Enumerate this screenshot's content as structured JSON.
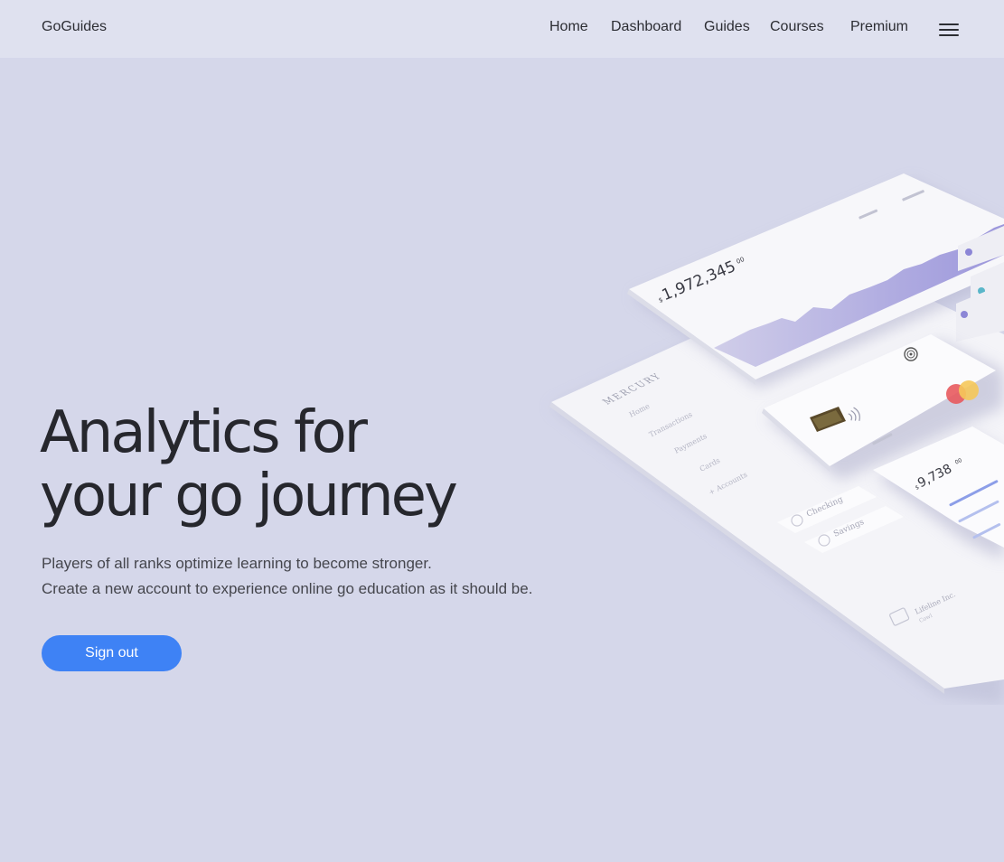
{
  "brand": "GoGuides",
  "nav": {
    "home": "Home",
    "dashboard": "Dashboard",
    "guides": "Guides",
    "courses": "Courses",
    "premium": "Premium"
  },
  "hero": {
    "title_line1": "Analytics for",
    "title_line2": "your go journey",
    "subtitle_line1": "Players of all ranks optimize learning to become stronger.",
    "subtitle_line2": "Create a new account to experience online go education as it should be.",
    "cta_label": "Sign out"
  },
  "illustration": {
    "balance": "1,972,345",
    "balance_cents": "00",
    "card_balance": "9,738",
    "card_cents": "00",
    "sidebar_brand": "MERCURY",
    "sidebar_items": [
      "Home",
      "Transactions",
      "Payments",
      "Cards",
      "+ Accounts"
    ],
    "account_checking": "Checking",
    "account_savings": "Savings",
    "company": "Lifeline Inc.",
    "company_sub": "Cowl"
  },
  "colors": {
    "background": "#d5d7ea",
    "navbar": "#dfe1ef",
    "accent": "#3e82f5"
  },
  "icons": [
    "hamburger-menu-icon",
    "card-chip-icon",
    "contactless-icon",
    "mastercard-logo-icon",
    "fingerprint-icon"
  ]
}
